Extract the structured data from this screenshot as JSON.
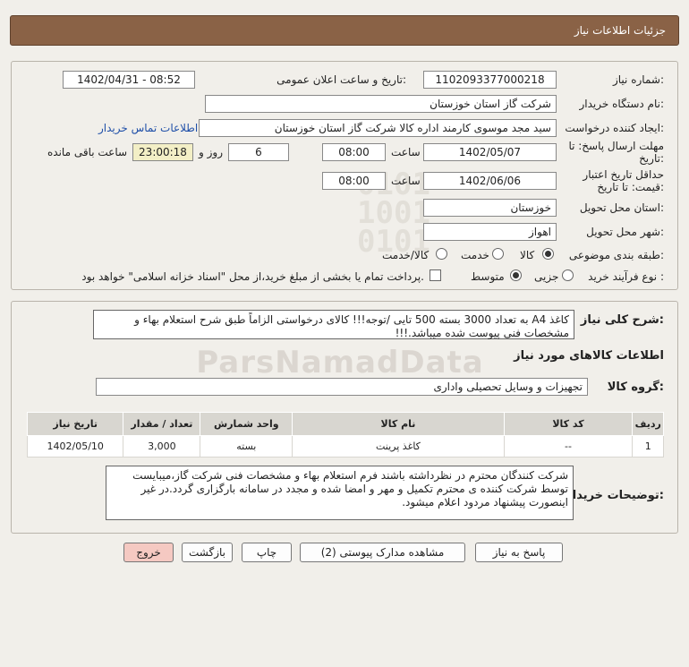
{
  "header": {
    "title": "جزئیات اطلاعات نیاز"
  },
  "form": {
    "need_number_label": "شماره نیاز:",
    "need_number": "1102093377000218",
    "announce_label": "تاریخ و ساعت اعلان عمومی:",
    "announce_value": "1402/04/31 - 08:52",
    "buyer_label": "نام دستگاه خریدار:",
    "buyer_value": "شرکت گاز استان خوزستان",
    "creator_label": "ایجاد کننده درخواست:",
    "creator_value": "سید مجد موسوی کارمند اداره کالا شرکت گاز استان خوزستان",
    "contact_link": "اطلاعات تماس خریدار",
    "deadline_label_1": "مهلت ارسال پاسخ: تا",
    "deadline_label_2": "تاریخ:",
    "deadline_date": "1402/05/07",
    "time_label": "ساعت",
    "deadline_time": "08:00",
    "days_value": "6",
    "days_label": "روز و",
    "remaining_time": "23:00:18",
    "remaining_label": "ساعت باقی مانده",
    "validity_label_1": "حداقل تاریخ اعتبار",
    "validity_label_2": "قیمت: تا تاریخ:",
    "validity_date": "1402/06/06",
    "validity_time_label": "ساعت",
    "validity_time": "08:00",
    "province_label": "استان محل تحویل:",
    "province_value": "خوزستان",
    "city_label": "شهر محل تحویل:",
    "city_value": "اهواز",
    "category_label": "طبقه بندی موضوعی:",
    "category_options": [
      "کالا",
      "خدمت",
      "کالا/خدمت"
    ],
    "category_selected": "کالا",
    "process_label": "نوع فرآیند خرید :",
    "process_options": [
      "جزیی",
      "متوسط"
    ],
    "process_selected": "متوسط",
    "payment_note": "پرداخت تمام یا بخشی از مبلغ خرید،از محل \"اسناد خزانه اسلامی\" خواهد بود."
  },
  "description": {
    "label": "شرح کلی نیاز:",
    "text": "کاغذ A4 به تعداد 3000 بسته 500 تایی /توجه!!! کالای درخواستی الزاماً طبق شرح استعلام بهاء و مشخصات فنی پیوست شده میباشد.!!!"
  },
  "goods": {
    "section_title": "اطلاعات کالاهای مورد نیاز",
    "group_label": "گروه کالا:",
    "group_value": "تجهیزات و وسایل تحصیلی واداری",
    "columns": [
      "ردیف",
      "کد کالا",
      "نام کالا",
      "واحد شمارش",
      "تعداد / مقدار",
      "تاریخ نیاز"
    ],
    "rows": [
      {
        "row": "1",
        "code": "--",
        "name": "کاغذ پرینت",
        "unit": "بسته",
        "qty": "3,000",
        "date": "1402/05/10"
      }
    ]
  },
  "buyer_notes": {
    "label": "توضیحات خریدار:",
    "text": "شرکت کنندگان محترم در نظرداشته باشند فرم استعلام بهاء و مشخصات فنی شرکت گاز،میبایست توسط شرکت کننده ی محترم  تکمیل و مهر و امضا شده و مجدد در سامانه بارگزاری گردد.در غیر اینصورت پیشنهاد مردود اعلام میشود."
  },
  "buttons": {
    "reply": "پاسخ به نیاز",
    "attachments": "مشاهده مدارک پیوستی (2)",
    "print": "چاپ",
    "back": "بازگشت",
    "exit": "خروج"
  },
  "watermark": {
    "text": "ParsNamadData"
  },
  "colors": {
    "header_bg": "#8a6246",
    "panel_bg": "#f1efea",
    "link": "#1f4fa8",
    "yellow_field": "#f3efc6",
    "exit_btn": "#f5c9c2"
  }
}
